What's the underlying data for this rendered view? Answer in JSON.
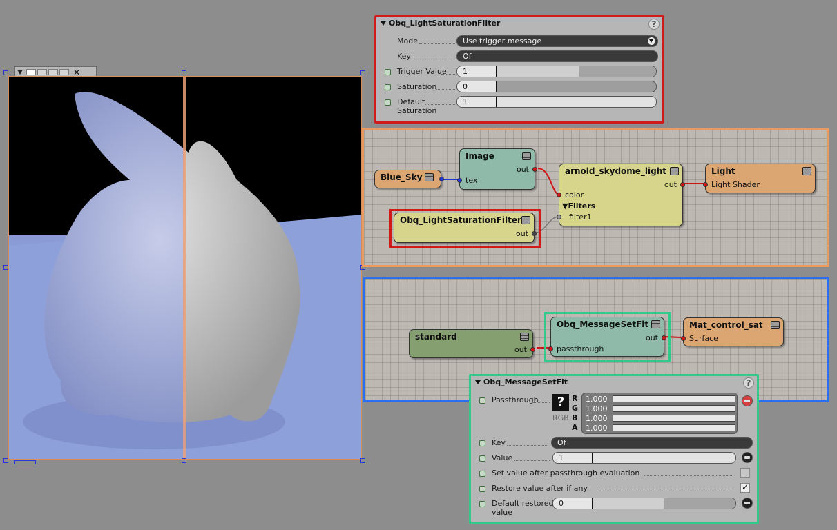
{
  "render_view": {
    "toolbar_close": "✕"
  },
  "light_panel": {
    "title": "Obq_LightSaturationFilter",
    "help": "?",
    "mode_label": "Mode",
    "mode_value": "Use trigger message",
    "key_label": "Key",
    "key_value": "Of",
    "trigger_label": "Trigger Value",
    "trigger_value": "1",
    "saturation_label": "Saturation",
    "saturation_value": "0",
    "default_sat_label_1": "Default",
    "default_sat_label_2": "Saturation",
    "default_sat_value": "1"
  },
  "graph_orange": {
    "blue_sky": {
      "title": "Blue_Sky"
    },
    "image": {
      "title": "Image",
      "out": "out",
      "tex": "tex"
    },
    "skydome": {
      "title": "arnold_skydome_light",
      "color": "color",
      "filters": "Filters",
      "filter1": "filter1",
      "out": "out"
    },
    "light": {
      "title": "Light",
      "light_shader": "Light Shader"
    },
    "filter_node": {
      "title": "Obq_LightSaturationFilter",
      "out": "out"
    }
  },
  "graph_blue": {
    "standard": {
      "title": "standard",
      "out": "out"
    },
    "msgset": {
      "title": "Obq_MessageSetFlt",
      "passthrough": "passthrough",
      "out": "out"
    },
    "mat": {
      "title": "Mat_control_sat",
      "surface": "Surface"
    }
  },
  "msg_panel": {
    "title": "Obq_MessageSetFlt",
    "help": "?",
    "passthrough_label": "Passthrough",
    "rgb_label": "RGB",
    "swatch_icon": "?",
    "r_label": "R",
    "g_label": "G",
    "b_label": "B",
    "a_label": "A",
    "r_value": "1.000",
    "g_value": "1.000",
    "b_value": "1.000",
    "a_value": "1.000",
    "key_label": "Key",
    "key_value": "Of",
    "value_label": "Value",
    "value_value": "1",
    "set_after_label": "Set value after passthrough evaluation",
    "restore_label": "Restore value after if any",
    "default_restored_label_1": "Default restored",
    "default_restored_label_2": "value",
    "default_restored_value": "0"
  },
  "colors": {
    "red_frame": "#d11a1a",
    "orange_frame": "#e89a60",
    "blue_frame": "#2a6ff2",
    "green_frame": "#33c98a"
  }
}
